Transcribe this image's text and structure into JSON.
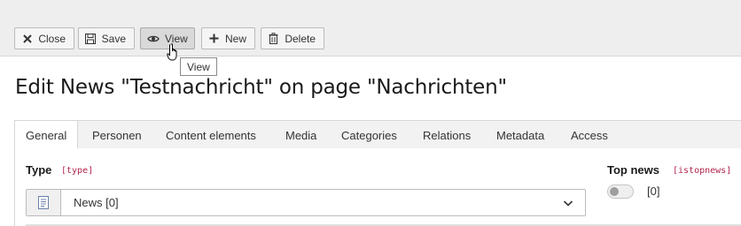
{
  "toolbar": {
    "buttons": [
      {
        "label": "Close",
        "icon": "close-icon"
      },
      {
        "label": "Save",
        "icon": "save-icon"
      },
      {
        "label": "View",
        "icon": "eye-icon"
      },
      {
        "label": "New",
        "icon": "plus-icon"
      },
      {
        "label": "Delete",
        "icon": "trash-icon"
      }
    ],
    "tooltip": "View"
  },
  "page_title": "Edit News \"Testnachricht\" on page \"Nachrichten\"",
  "tabs": [
    "General",
    "Personen",
    "Content elements",
    "Media",
    "Categories",
    "Relations",
    "Metadata",
    "Access"
  ],
  "form": {
    "type_label": "Type",
    "type_code": "[type]",
    "type_value": "News [0]",
    "top_news_label": "Top news",
    "top_news_code": "[istopnews]",
    "top_news_value": "[0]",
    "top_news_checked": false
  },
  "colors": {
    "code": "#b3264d",
    "toolbar_bg": "#eeeeee",
    "tab_bg": "#f2f2f2"
  }
}
